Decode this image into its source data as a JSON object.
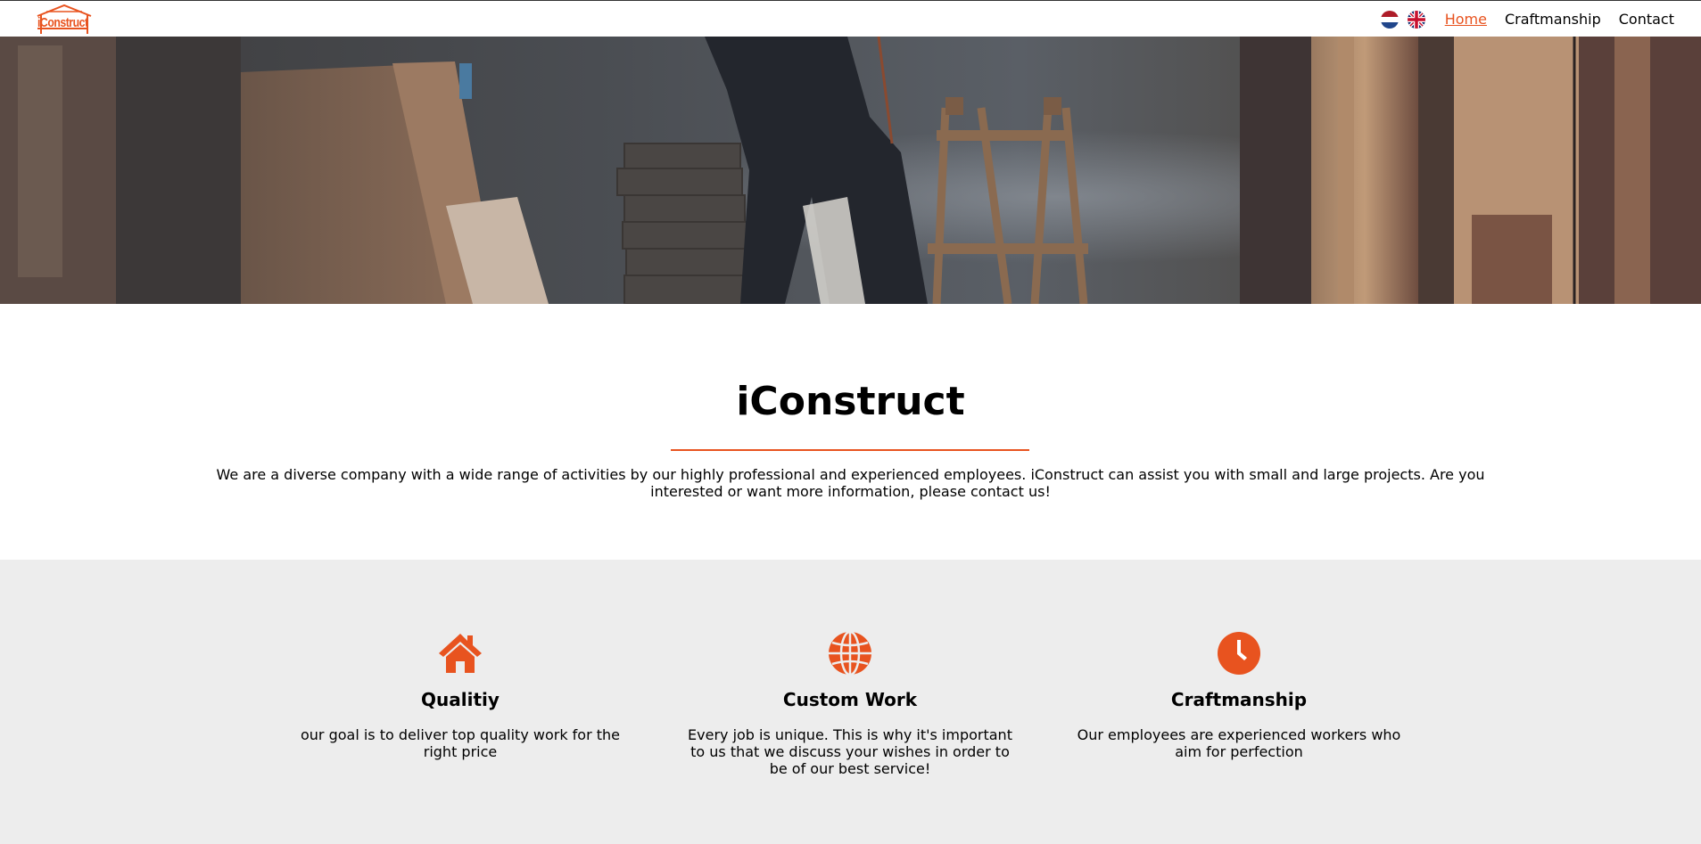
{
  "header": {
    "logo_text": "iConstruct",
    "flags": [
      {
        "name": "netherlands-flag-icon"
      },
      {
        "name": "uk-flag-icon"
      }
    ],
    "nav": [
      {
        "label": "Home",
        "active": true
      },
      {
        "label": "Craftmanship",
        "active": false
      },
      {
        "label": "Contact",
        "active": false
      }
    ]
  },
  "intro": {
    "title": "iConstruct",
    "text": "We are a diverse company with a wide range of activities by our highly professional and experienced employees. iConstruct can assist you with small and large projects. Are you interested or want more information, please contact us!"
  },
  "features": [
    {
      "icon": "house-icon",
      "title": "Qualitiy",
      "text": "our goal is to deliver top quality work for the right price"
    },
    {
      "icon": "globe-icon",
      "title": "Custom Work",
      "text": "Every job is unique. This is why it's important to us that we discuss your wishes in order to be of our best service!"
    },
    {
      "icon": "clock-icon",
      "title": "Craftmanship",
      "text": "Our employees are experienced workers who aim for perfection"
    }
  ],
  "colors": {
    "accent": "#e8531f",
    "features_bg": "#ededed"
  }
}
